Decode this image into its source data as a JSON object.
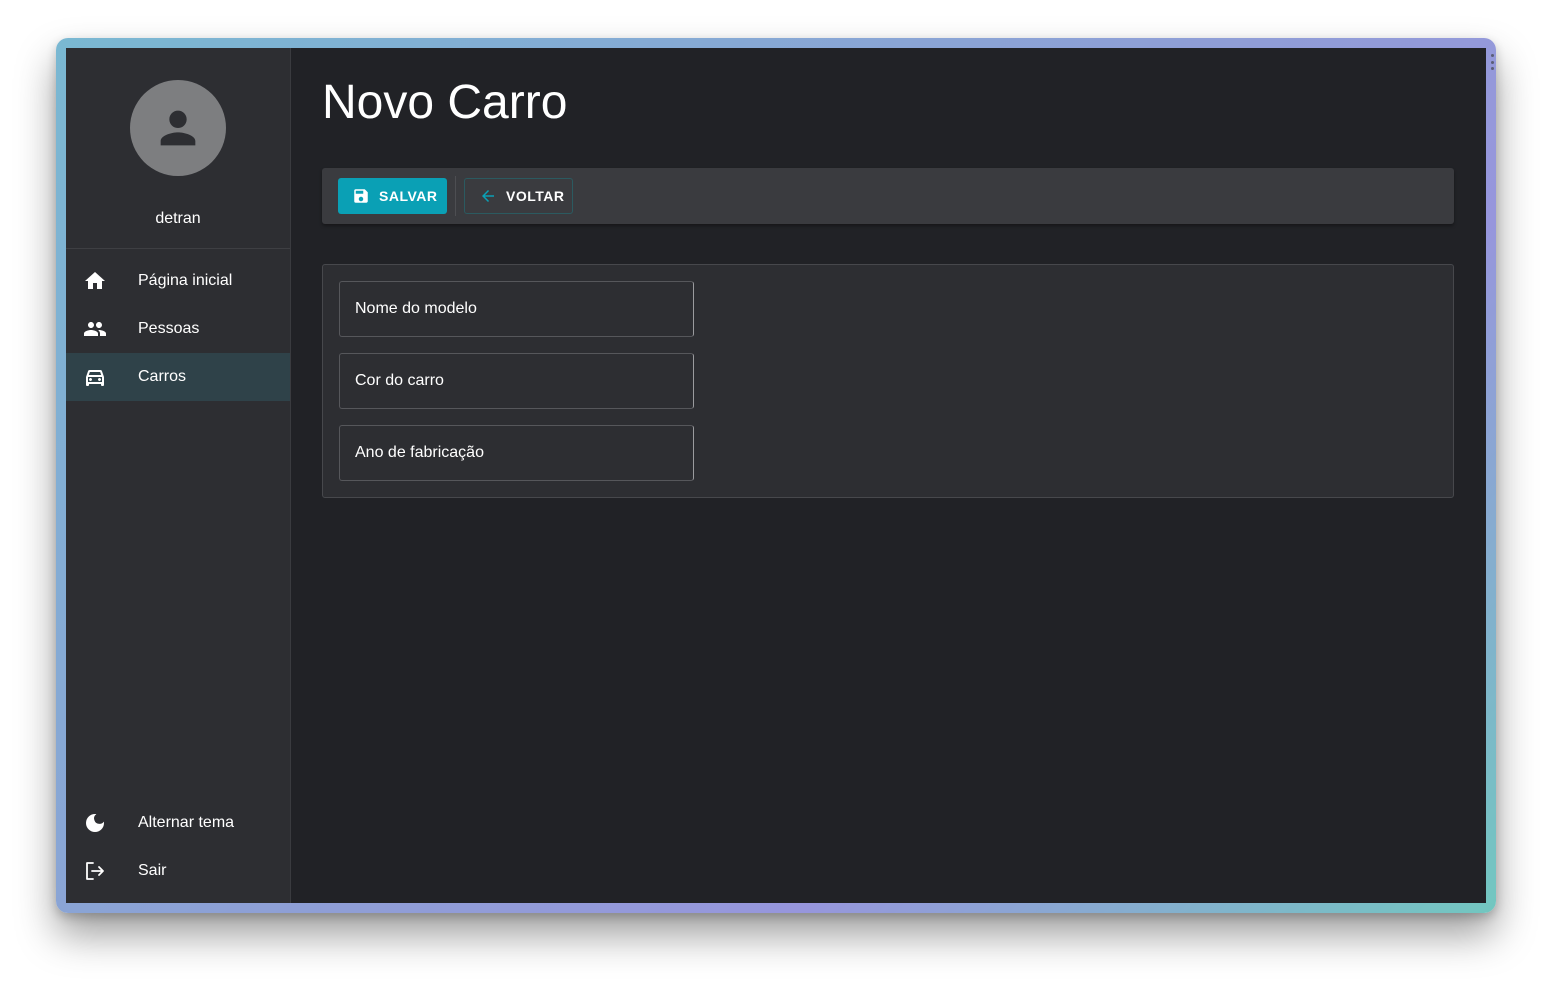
{
  "sidebar": {
    "username": "detran",
    "nav_items": [
      {
        "label": "Página inicial",
        "icon": "home-icon"
      },
      {
        "label": "Pessoas",
        "icon": "people-icon"
      },
      {
        "label": "Carros",
        "icon": "car-icon",
        "active": true
      }
    ],
    "bottom_items": [
      {
        "label": "Alternar tema",
        "icon": "moon-icon"
      },
      {
        "label": "Sair",
        "icon": "logout-icon"
      }
    ]
  },
  "main": {
    "title": "Novo Carro",
    "toolbar": {
      "save_label": "SALVAR",
      "back_label": "VOLTAR"
    },
    "form": {
      "fields": [
        {
          "placeholder": "Nome do modelo",
          "value": ""
        },
        {
          "placeholder": "Cor do carro",
          "value": ""
        },
        {
          "placeholder": "Ano de fabricação",
          "value": ""
        }
      ]
    }
  },
  "colors": {
    "accent": "#0aa0b5",
    "background": "#212226",
    "sidebar": "#2d2e32",
    "active_nav": "#2f4249"
  }
}
